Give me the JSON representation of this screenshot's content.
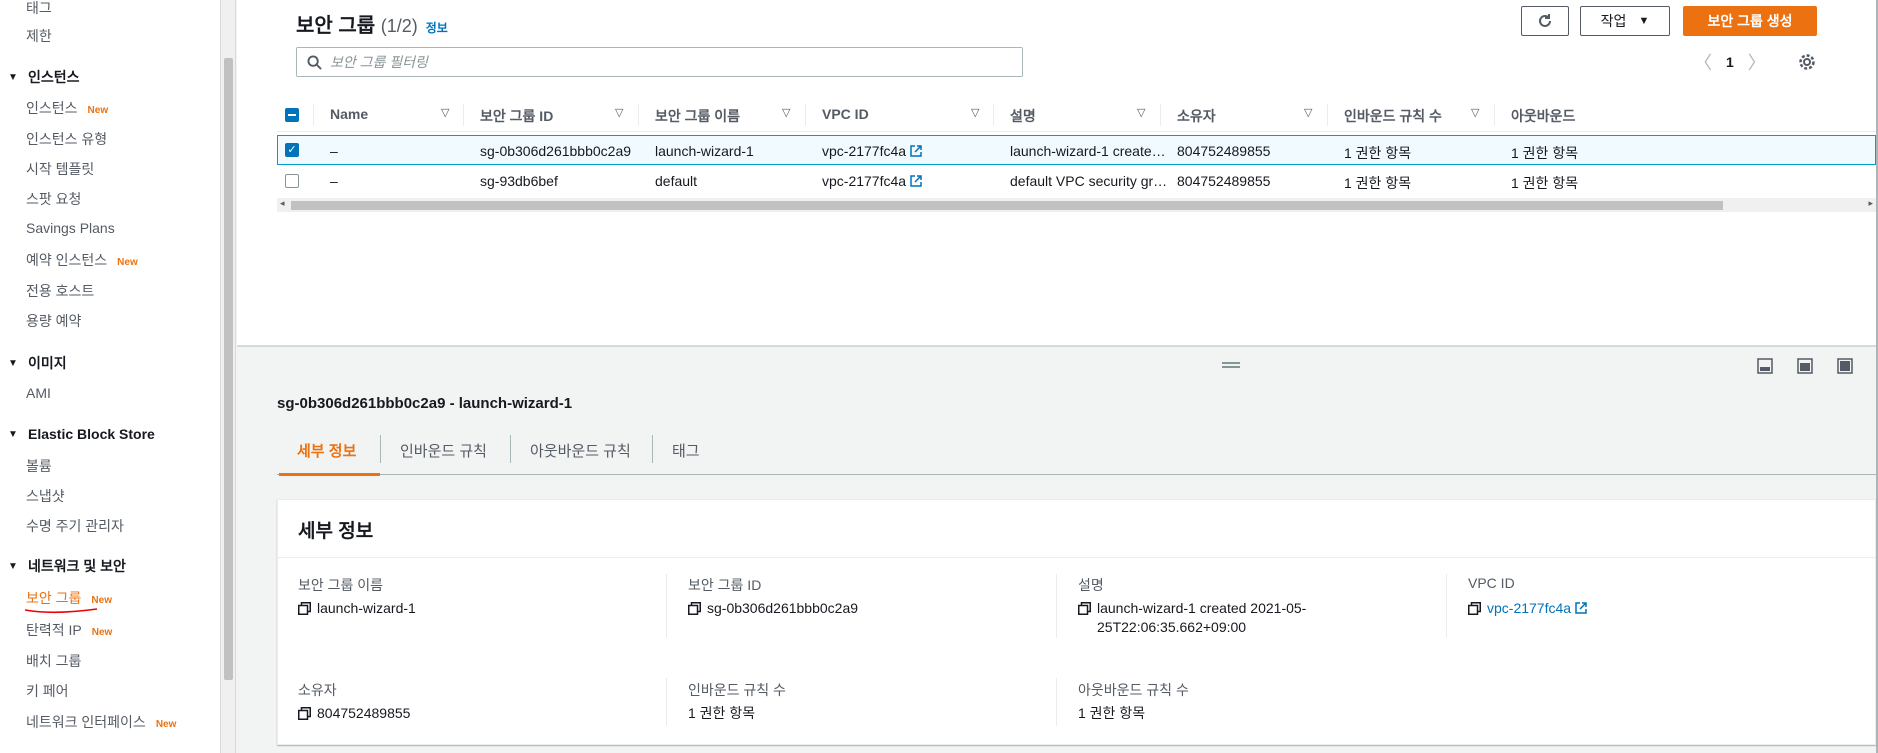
{
  "sidebar": {
    "top_items": [
      "태그",
      "제한"
    ],
    "sections": [
      {
        "title": "인스턴스",
        "items": [
          {
            "label": "인스턴스",
            "new": "New"
          },
          {
            "label": "인스턴스 유형",
            "new": ""
          },
          {
            "label": "시작 템플릿",
            "new": ""
          },
          {
            "label": "스팟 요청",
            "new": ""
          },
          {
            "label": "Savings Plans",
            "new": ""
          },
          {
            "label": "예약 인스턴스",
            "new": "New"
          },
          {
            "label": "전용 호스트",
            "new": ""
          },
          {
            "label": "용량 예약",
            "new": ""
          }
        ]
      },
      {
        "title": "이미지",
        "items": [
          {
            "label": "AMI",
            "new": ""
          }
        ]
      },
      {
        "title": "Elastic Block Store",
        "items": [
          {
            "label": "볼륨",
            "new": ""
          },
          {
            "label": "스냅샷",
            "new": ""
          },
          {
            "label": "수명 주기 관리자",
            "new": ""
          }
        ]
      },
      {
        "title": "네트워크 및 보안",
        "items": [
          {
            "label": "보안 그룹",
            "new": "New"
          },
          {
            "label": "탄력적 IP",
            "new": "New"
          },
          {
            "label": "배치 그룹",
            "new": ""
          },
          {
            "label": "키 페어",
            "new": ""
          },
          {
            "label": "네트워크 인터페이스",
            "new": "New"
          }
        ]
      }
    ]
  },
  "header": {
    "title": "보안 그룹",
    "count": "(1/2)",
    "info": "정보",
    "actions_label": "작업",
    "create_label": "보안 그룹 생성",
    "search_placeholder": "보안 그룹 필터링",
    "page": "1"
  },
  "table": {
    "columns": [
      "Name",
      "보안 그룹 ID",
      "보안 그룹 이름",
      "VPC ID",
      "설명",
      "소유자",
      "인바운드 규칙 수",
      "아웃바운드"
    ],
    "rows": [
      {
        "name": "–",
        "sg_id": "sg-0b306d261bbb0c2a9",
        "sg_name": "launch-wizard-1",
        "vpc": "vpc-2177fc4a",
        "desc": "launch-wizard-1 create…",
        "owner": "804752489855",
        "inbound": "1 권한 항목",
        "outbound": "1 권한 항목",
        "selected": true
      },
      {
        "name": "–",
        "sg_id": "sg-93db6bef",
        "sg_name": "default",
        "vpc": "vpc-2177fc4a",
        "desc": "default VPC security gr…",
        "owner": "804752489855",
        "inbound": "1 권한 항목",
        "outbound": "1 권한 항목",
        "selected": false
      }
    ]
  },
  "detail": {
    "title": "sg-0b306d261bbb0c2a9 - launch-wizard-1",
    "tabs": [
      "세부 정보",
      "인바운드 규칙",
      "아웃바운드 규칙",
      "태그"
    ],
    "card_title": "세부 정보",
    "fields": {
      "sg_name_label": "보안 그룹 이름",
      "sg_name": "launch-wizard-1",
      "sg_id_label": "보안 그룹 ID",
      "sg_id": "sg-0b306d261bbb0c2a9",
      "desc_label": "설명",
      "desc_line1": "launch-wizard-1 created 2021-05-",
      "desc_line2": "25T22:06:35.662+09:00",
      "vpc_label": "VPC ID",
      "vpc": "vpc-2177fc4a",
      "owner_label": "소유자",
      "owner": "804752489855",
      "inbound_label": "인바운드 규칙 수",
      "inbound": "1 권한 항목",
      "outbound_label": "아웃바운드 규칙 수",
      "outbound": "1 권한 항목"
    }
  },
  "colors": {
    "accent": "#ec7211",
    "link": "#0073bb",
    "selected_border": "#00a1c9"
  }
}
